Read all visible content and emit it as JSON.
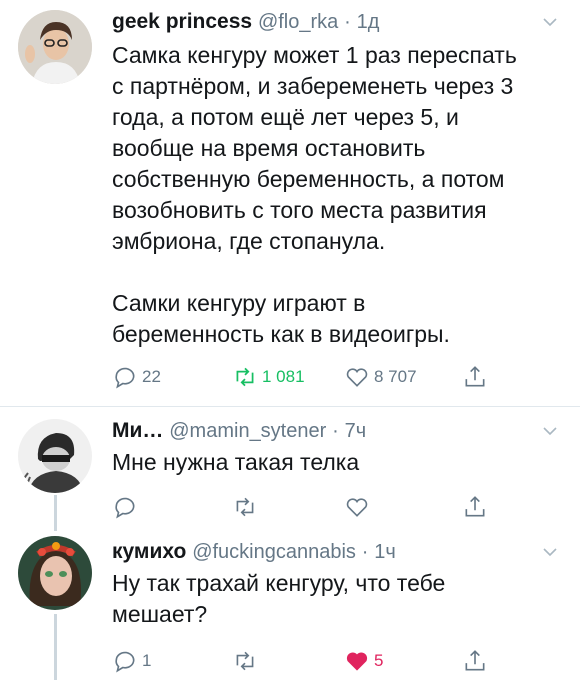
{
  "tweets": [
    {
      "name": "geek princess",
      "handle": "@flo_rka",
      "time": "1д",
      "text": "Самка кенгуру может 1 раз переспать\nс партнёром, и забеременеть через 3\nгода, а потом ещё лет через 5, и\nвообще на время остановить\nсобственную беременность, а потом\nвозобновить с того места развития\nэмбриона, где стопанула.\n\nСамки кенгуру играют в\nбеременность как в видеоигры.",
      "replies": "22",
      "retweets": "1 081",
      "likes": "8 707"
    },
    {
      "name": "Ми…",
      "handle": "@mamin_sytener",
      "time": "7ч",
      "text": "Мне нужна такая телка",
      "replies": "",
      "retweets": "",
      "likes": ""
    },
    {
      "name": "кумихо",
      "handle": "@fuckingcannabis",
      "time": "1ч",
      "text": "Ну так трахай кенгуру, что тебе\nмешает?",
      "replies": "1",
      "retweets": "",
      "likes": "5"
    }
  ],
  "colors": {
    "text": "#14171a",
    "meta": "#657786",
    "liked": "#e0245e",
    "line": "#ccd6dd"
  }
}
